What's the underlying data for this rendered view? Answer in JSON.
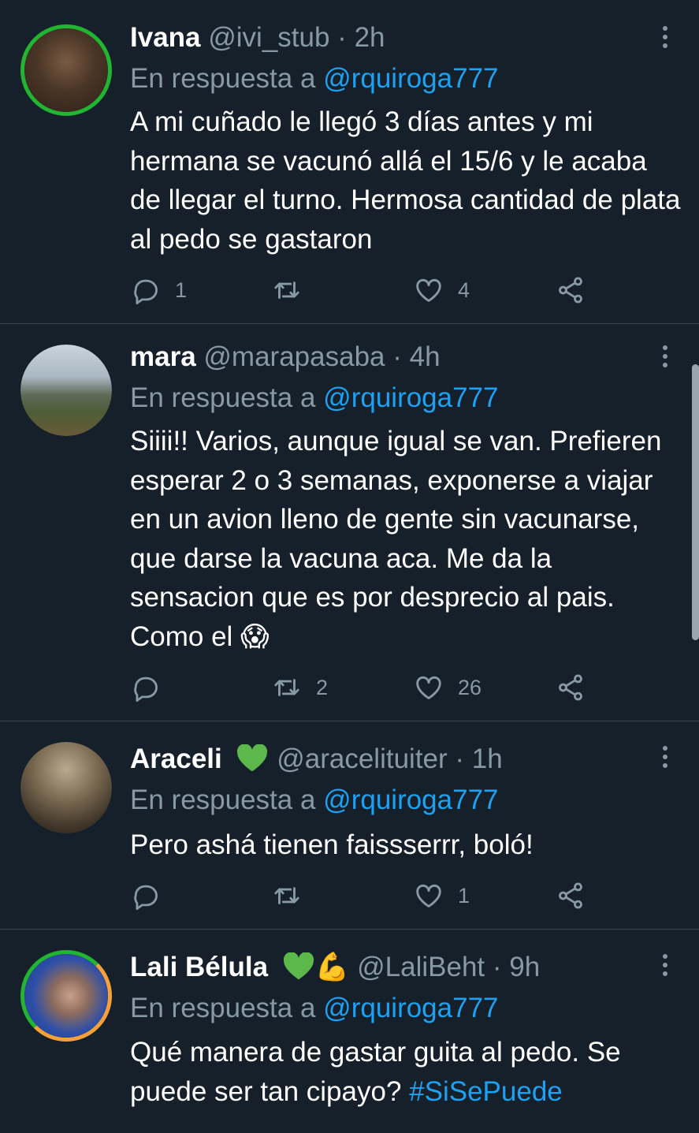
{
  "reply_prefix": "En respuesta a",
  "colors": {
    "background": "#15202b",
    "text": "#ffffff",
    "muted": "#8899a6",
    "accent": "#1da1f2",
    "divider": "#38444d"
  },
  "tweets": [
    {
      "name": "Ivana",
      "handle": "@ivi_stub",
      "dot": "·",
      "time": "2h",
      "reply_to": "@rquiroga777",
      "text": "A mi cuñado le llegó 3 días antes y mi hermana se vacunó allá el 15/6 y le acaba de llegar el turno. Hermosa cantidad de plata al pedo se gastaron",
      "replies": "1",
      "retweets": "",
      "likes": "4"
    },
    {
      "name": "mara",
      "handle": "@marapasaba",
      "dot": "·",
      "time": "4h",
      "reply_to": "@rquiroga777",
      "text": "Siiii!! Varios, aunque igual se van. Prefieren esperar 2 o 3 semanas, exponerse a viajar en un avion lleno de gente sin vacunarse, que darse la vacuna aca. Me da la sensacion que es por desprecio al pais. Como el",
      "emoji": "😱",
      "replies": "",
      "retweets": "2",
      "likes": "26"
    },
    {
      "name": "Araceli",
      "handle": "@aracelituiter",
      "dot": "·",
      "time": "1h",
      "reply_to": "@rquiroga777",
      "text": "Pero ashá tienen faissserrr, boló!",
      "replies": "",
      "retweets": "",
      "likes": "1"
    },
    {
      "name": "Lali Bélula",
      "handle": "@LaliBeht",
      "dot": "·",
      "time": "9h",
      "reply_to": "@rquiroga777",
      "text": "Qué manera de gastar guita al pedo. Se puede ser tan cipayo?",
      "hashtag": "#SiSePuede",
      "name_emoji": "💪",
      "replies": "",
      "retweets": "",
      "likes": ""
    }
  ]
}
